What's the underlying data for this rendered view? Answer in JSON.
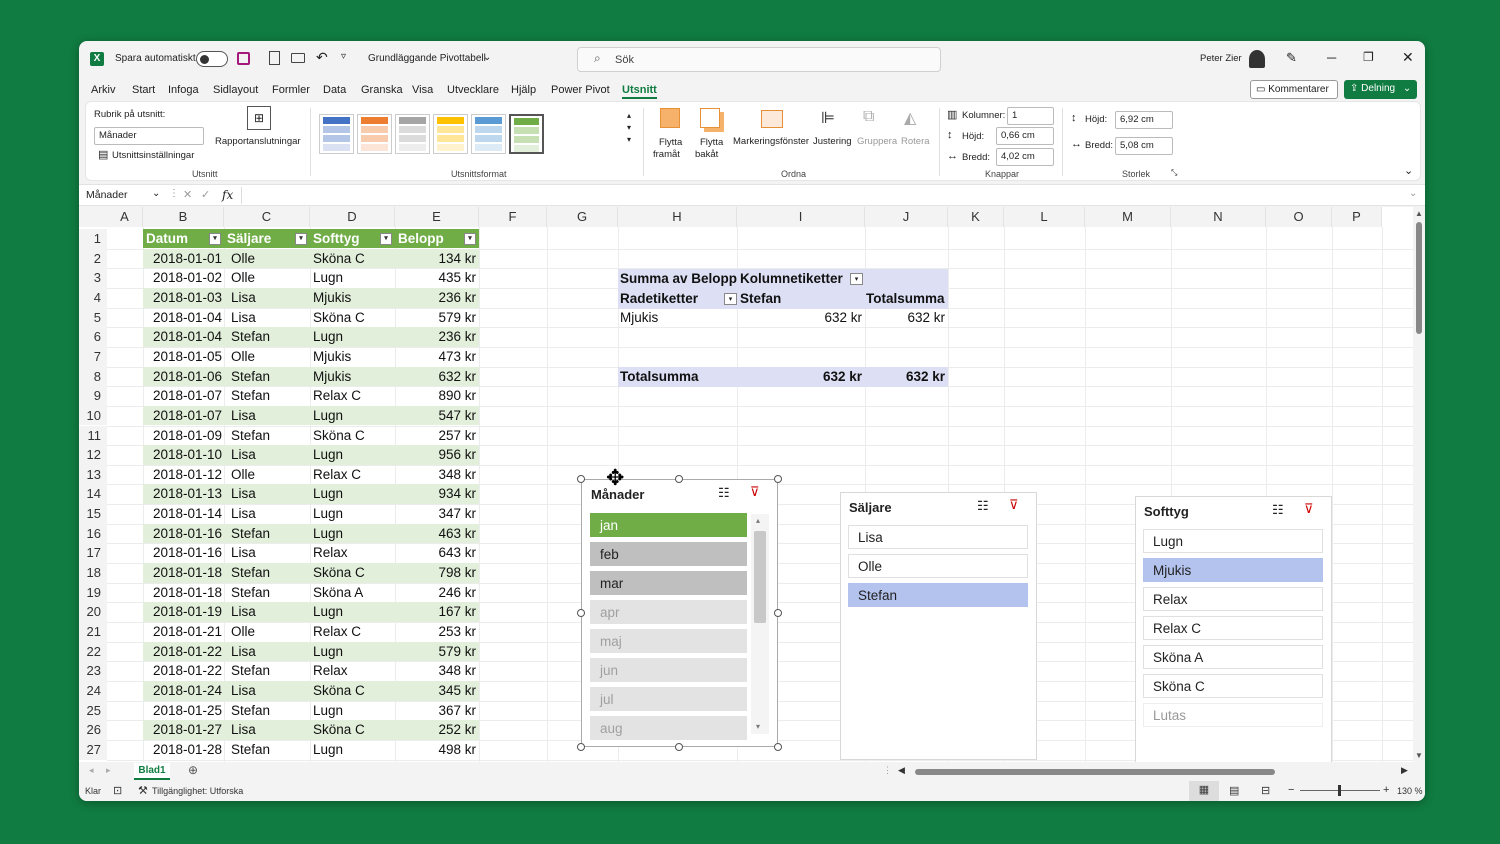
{
  "titlebar": {
    "autosave_label": "Spara automatiskt",
    "doc_title": "Grundläggande Pivottabell",
    "search_placeholder": "Sök",
    "user": "Peter Zier"
  },
  "tabs": [
    "Arkiv",
    "Start",
    "Infoga",
    "Sidlayout",
    "Formler",
    "Data",
    "Granska",
    "Visa",
    "Utvecklare",
    "Hjälp",
    "Power Pivot",
    "Utsnitt"
  ],
  "active_tab": "Utsnitt",
  "comments_label": "Kommentarer",
  "share_label": "Delning",
  "ribbon": {
    "caption_label": "Rubrik på utsnitt:",
    "caption_value": "Månader",
    "report_conn": "Rapportanslutningar",
    "settings": "Utsnittsinställningar",
    "group_utsnitt": "Utsnitt",
    "group_format": "Utsnittsformat",
    "move_forward": "Flytta",
    "move_forward2": "framåt",
    "move_back": "Flytta",
    "move_back2": "bakåt",
    "selection_pane": "Markeringsfönster",
    "align": "Justering",
    "group": "Gruppera",
    "rotate": "Rotera",
    "group_arrange": "Ordna",
    "columns_label": "Kolumner:",
    "columns_value": "1",
    "btn_height_label": "Höjd:",
    "btn_height_value": "0,66 cm",
    "btn_width_label": "Bredd:",
    "btn_width_value": "4,02 cm",
    "group_buttons": "Knappar",
    "height_label": "Höjd:",
    "height_value": "6,92 cm",
    "width_label": "Bredd:",
    "width_value": "5,08 cm",
    "group_size": "Storlek"
  },
  "formula": {
    "name_box": "Månader",
    "fx": "fx"
  },
  "columns": [
    "A",
    "B",
    "C",
    "D",
    "E",
    "F",
    "G",
    "H",
    "I",
    "J",
    "K",
    "L",
    "M",
    "N",
    "O",
    "P"
  ],
  "table_headers": [
    "Datum",
    "Säljare",
    "Softtyg",
    "Belopp"
  ],
  "rows": [
    [
      "2018-01-01",
      "Olle",
      "Sköna C",
      "134 kr"
    ],
    [
      "2018-01-02",
      "Olle",
      "Lugn",
      "435 kr"
    ],
    [
      "2018-01-03",
      "Lisa",
      "Mjukis",
      "236 kr"
    ],
    [
      "2018-01-04",
      "Lisa",
      "Sköna C",
      "579 kr"
    ],
    [
      "2018-01-04",
      "Stefan",
      "Lugn",
      "236 kr"
    ],
    [
      "2018-01-05",
      "Olle",
      "Mjukis",
      "473 kr"
    ],
    [
      "2018-01-06",
      "Stefan",
      "Mjukis",
      "632 kr"
    ],
    [
      "2018-01-07",
      "Stefan",
      "Relax C",
      "890 kr"
    ],
    [
      "2018-01-07",
      "Lisa",
      "Lugn",
      "547 kr"
    ],
    [
      "2018-01-09",
      "Stefan",
      "Sköna C",
      "257 kr"
    ],
    [
      "2018-01-10",
      "Lisa",
      "Lugn",
      "956 kr"
    ],
    [
      "2018-01-12",
      "Olle",
      "Relax C",
      "348 kr"
    ],
    [
      "2018-01-13",
      "Lisa",
      "Lugn",
      "934 kr"
    ],
    [
      "2018-01-14",
      "Lisa",
      "Lugn",
      "347 kr"
    ],
    [
      "2018-01-16",
      "Stefan",
      "Lugn",
      "463 kr"
    ],
    [
      "2018-01-16",
      "Lisa",
      "Relax",
      "643 kr"
    ],
    [
      "2018-01-18",
      "Stefan",
      "Sköna C",
      "798 kr"
    ],
    [
      "2018-01-18",
      "Stefan",
      "Sköna A",
      "246 kr"
    ],
    [
      "2018-01-19",
      "Lisa",
      "Lugn",
      "167 kr"
    ],
    [
      "2018-01-21",
      "Olle",
      "Relax C",
      "253 kr"
    ],
    [
      "2018-01-22",
      "Lisa",
      "Lugn",
      "579 kr"
    ],
    [
      "2018-01-22",
      "Stefan",
      "Relax",
      "348 kr"
    ],
    [
      "2018-01-24",
      "Lisa",
      "Sköna C",
      "345 kr"
    ],
    [
      "2018-01-25",
      "Stefan",
      "Lugn",
      "367 kr"
    ],
    [
      "2018-01-27",
      "Lisa",
      "Sköna C",
      "252 kr"
    ],
    [
      "2018-01-28",
      "Stefan",
      "Lugn",
      "498 kr"
    ]
  ],
  "pivot": {
    "sum_label": "Summa av Belopp",
    "col_labels": "Kolumnetiketter",
    "row_labels": "Radetiketter",
    "col1": "Stefan",
    "total_col": "Totalsumma",
    "row1": "Mjukis",
    "row1_v1": "632 kr",
    "row1_v2": "632 kr",
    "total_row": "Totalsumma",
    "total_v1": "632 kr",
    "total_v2": "632 kr"
  },
  "slicer_months": {
    "title": "Månader",
    "items": [
      {
        "label": "jan",
        "state": "selected"
      },
      {
        "label": "feb",
        "state": "data"
      },
      {
        "label": "mar",
        "state": "data"
      },
      {
        "label": "apr",
        "state": "nodata"
      },
      {
        "label": "maj",
        "state": "nodata"
      },
      {
        "label": "jun",
        "state": "nodata"
      },
      {
        "label": "jul",
        "state": "nodata"
      },
      {
        "label": "aug",
        "state": "nodata"
      }
    ]
  },
  "slicer_seller": {
    "title": "Säljare",
    "items": [
      {
        "label": "Lisa",
        "state": "normal"
      },
      {
        "label": "Olle",
        "state": "normal"
      },
      {
        "label": "Stefan",
        "state": "selected"
      }
    ]
  },
  "slicer_fabric": {
    "title": "Softtyg",
    "items": [
      {
        "label": "Lugn",
        "state": "normal"
      },
      {
        "label": "Mjukis",
        "state": "selected"
      },
      {
        "label": "Relax",
        "state": "normal"
      },
      {
        "label": "Relax C",
        "state": "normal"
      },
      {
        "label": "Sköna A",
        "state": "normal"
      },
      {
        "label": "Sköna C",
        "state": "normal"
      },
      {
        "label": "Lutas",
        "state": "nodata"
      }
    ]
  },
  "sheet_tab": "Blad1",
  "status": {
    "ready": "Klar",
    "accessibility": "Tillgänglighet: Utforska",
    "zoom": "130 %"
  },
  "colors": {
    "accent": "#107c41",
    "table_header": "#70ad47",
    "table_band": "#e2efda",
    "pivot_header": "#dde0f5",
    "slicer_selected_blue": "#b4c3ee",
    "slicer_selected_green": "#70ad47"
  }
}
